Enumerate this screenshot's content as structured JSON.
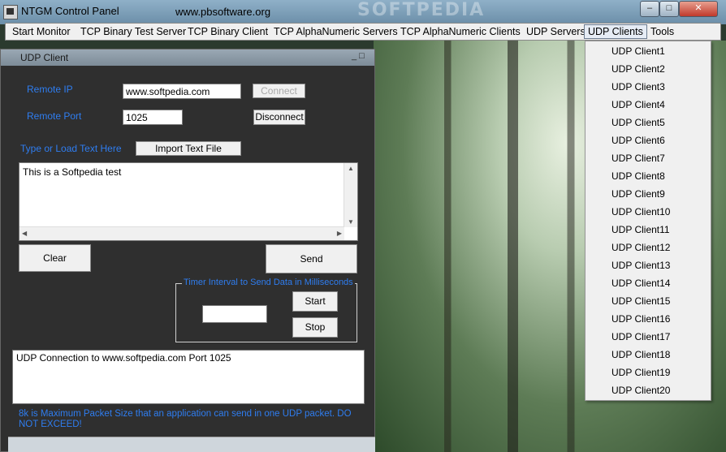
{
  "window": {
    "title": "NTGM Control Panel",
    "url": "www.pbsoftware.org",
    "watermark": "SOFTPEDIA"
  },
  "menu": [
    "Start Monitor",
    "TCP Binary Test Server",
    "TCP Binary Client",
    "TCP AlphaNumeric Servers",
    "TCP AlphaNumeric Clients",
    "UDP Servers",
    "UDP Clients",
    "Tools"
  ],
  "udp_client": {
    "title": "UDP Client",
    "remote_ip_label": "Remote IP",
    "remote_ip_value": "www.softpedia.com",
    "connect_label": "Connect",
    "remote_port_label": "Remote Port",
    "remote_port_value": "1025",
    "disconnect_label": "Disconnect",
    "type_label": "Type or Load Text Here",
    "import_label": "Import Text File",
    "text_value": "This is a Softpedia test",
    "clear_label": "Clear",
    "send_label": "Send",
    "timer_label": "Timer Interval to Send Data in Milliseconds",
    "timer_value": "",
    "start_label": "Start",
    "stop_label": "Stop",
    "log_value": "UDP Connection to www.softpedia.com Port  1025",
    "footer_note": "8k is Maximum Packet Size that an application can send in one UDP packet. DO NOT EXCEED!"
  },
  "dropdown": [
    "UDP Client1",
    "UDP Client2",
    "UDP Client3",
    "UDP Client4",
    "UDP Client5",
    "UDP Client6",
    "UDP Client7",
    "UDP Client8",
    "UDP Client9",
    "UDP Client10",
    "UDP Client11",
    "UDP Client12",
    "UDP Client13",
    "UDP Client14",
    "UDP Client15",
    "UDP Client16",
    "UDP Client17",
    "UDP Client18",
    "UDP Client19",
    "UDP Client20"
  ],
  "colors": {
    "label_blue": "#2f7df0",
    "panel_bg": "#2f2f2f"
  }
}
